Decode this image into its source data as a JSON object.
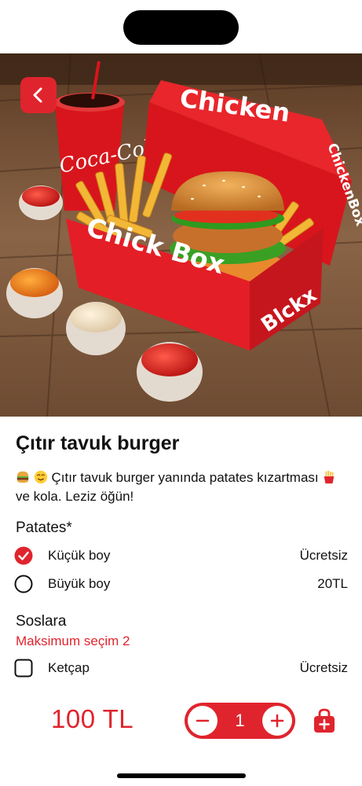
{
  "hero": {
    "cup_brand": "Coca-Cola",
    "box_lid_text": "Chicken",
    "box_front_text": "Chick Box",
    "box_side_text": "Blckx",
    "box_lid_side_text": "ChickenBox"
  },
  "product": {
    "title": "Çıtır tavuk burger",
    "description_part1": "Çıtır tavuk burger yanında patates kızartması",
    "description_part2": "ve kola. Leziz öğün!"
  },
  "options": {
    "patates": {
      "title": "Patates*",
      "items": [
        {
          "label": "Küçük boy",
          "price": "Ücretsiz",
          "selected": true
        },
        {
          "label": "Büyük boy",
          "price": "20TL",
          "selected": false
        }
      ]
    },
    "soslar": {
      "title": "Soslara",
      "subtitle": "Maksimum seçim 2",
      "items": [
        {
          "label": "Ketçap",
          "price": "Ücretsiz",
          "checked": false
        }
      ]
    }
  },
  "footer": {
    "price": "100 TL",
    "quantity": "1"
  },
  "colors": {
    "accent": "#e0242d",
    "text": "#111111",
    "background": "#ffffff"
  },
  "icons": [
    "back-arrow-icon",
    "burger-emoji-icon",
    "smile-emoji-icon",
    "fries-emoji-icon",
    "radio-checked-icon",
    "radio-empty-icon",
    "checkbox-empty-icon",
    "minus-icon",
    "plus-icon",
    "shopping-bag-icon"
  ]
}
